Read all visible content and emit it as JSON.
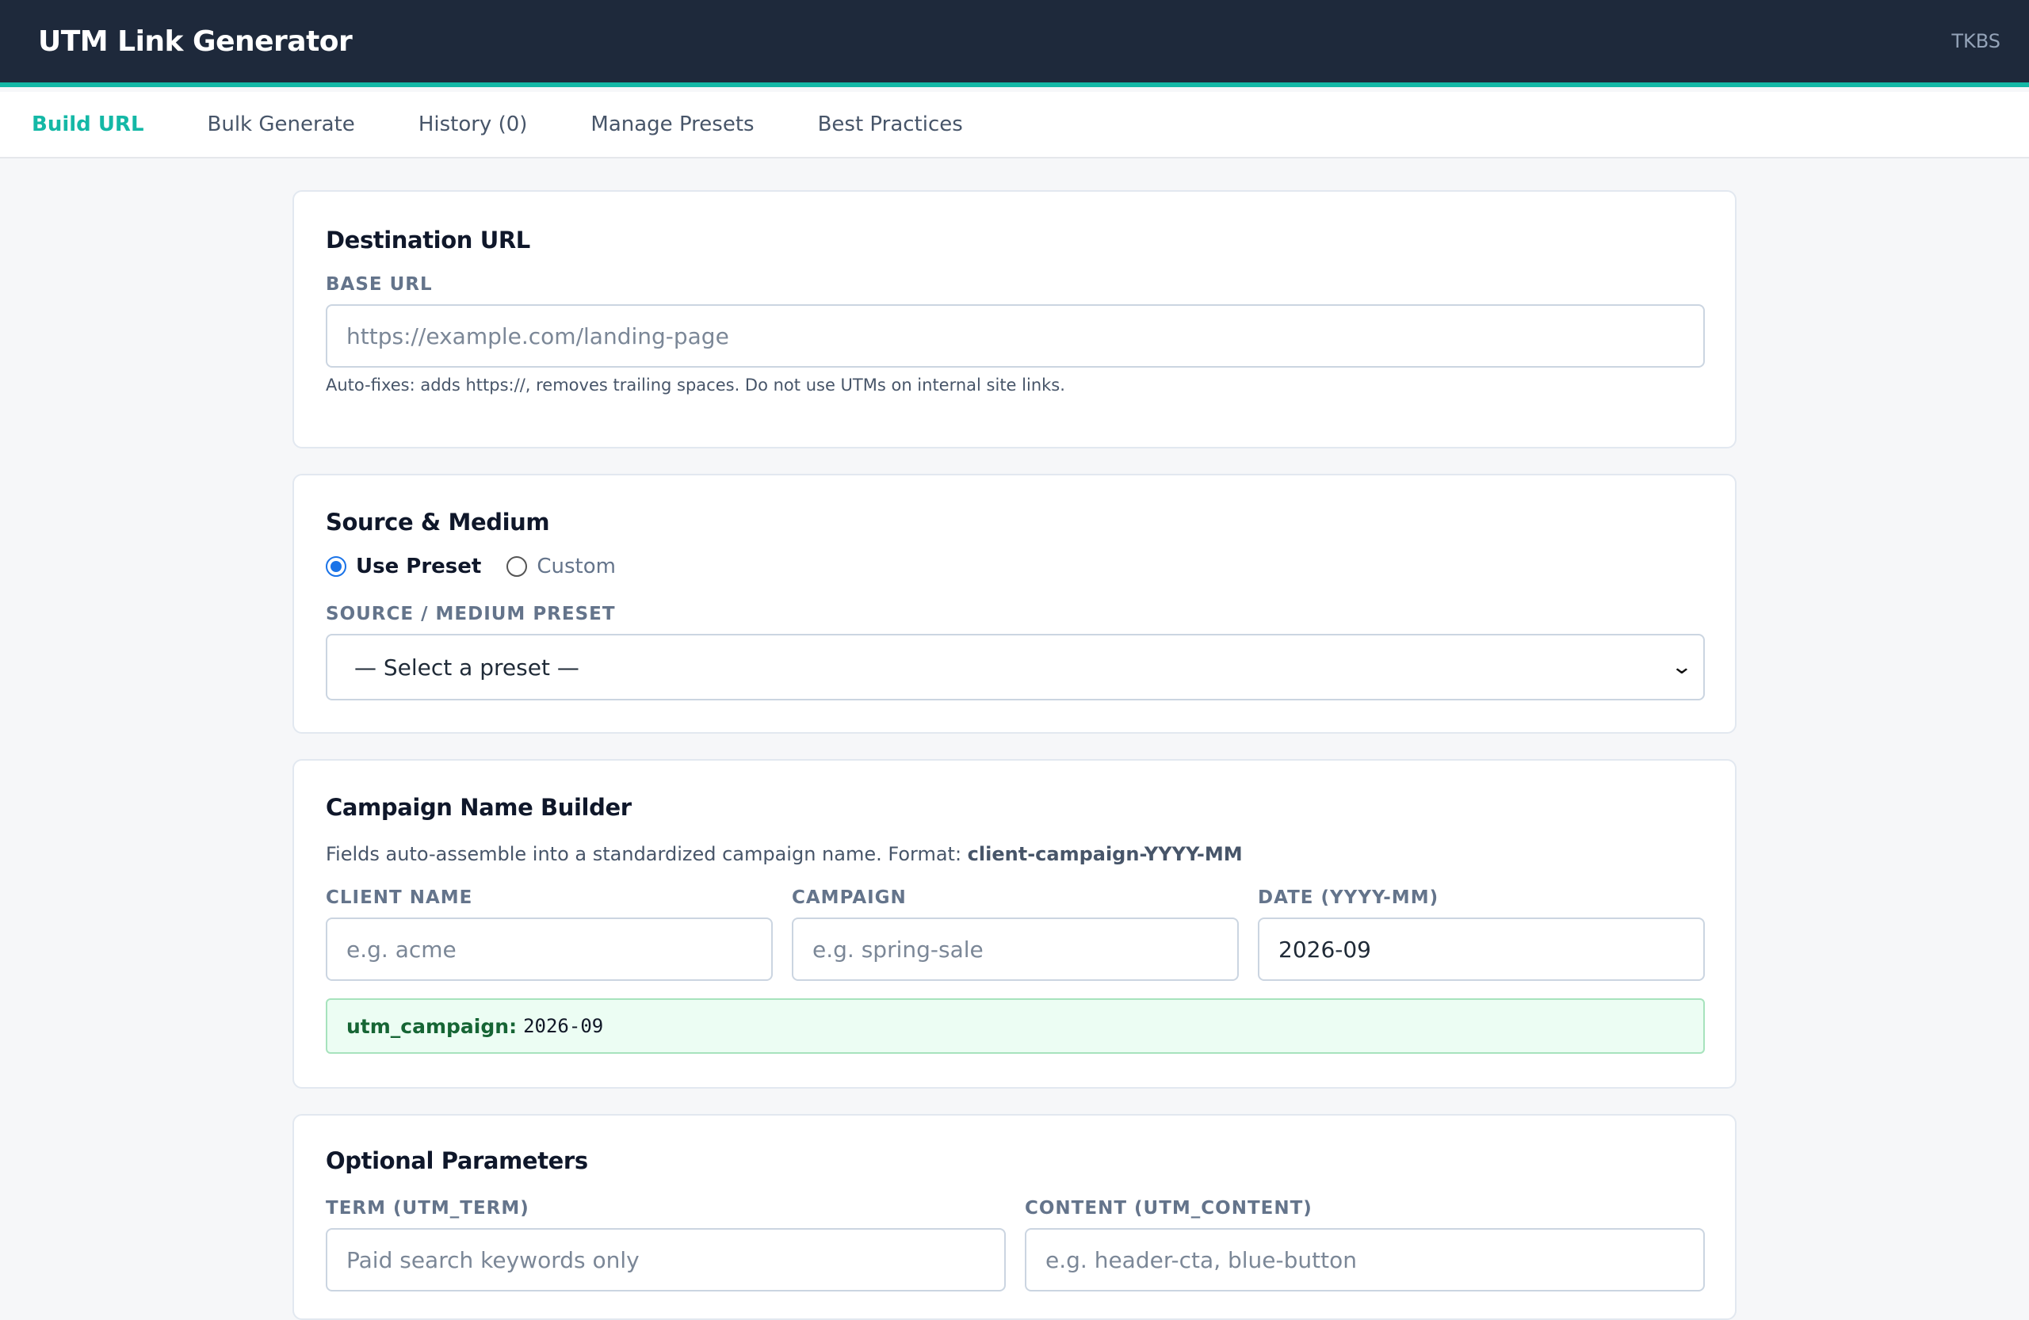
{
  "header": {
    "title": "UTM Link Generator",
    "user": "TKBS"
  },
  "tabs": [
    {
      "label": "Build URL",
      "active": true
    },
    {
      "label": "Bulk Generate",
      "active": false
    },
    {
      "label": "History (0)",
      "active": false
    },
    {
      "label": "Manage Presets",
      "active": false
    },
    {
      "label": "Best Practices",
      "active": false
    }
  ],
  "destination": {
    "title": "Destination URL",
    "base_url_label": "BASE URL",
    "base_url_placeholder": "https://example.com/landing-page",
    "base_url_value": "",
    "help": "Auto-fixes: adds https://, removes trailing spaces. Do not use UTMs on internal site links."
  },
  "source_medium": {
    "title": "Source & Medium",
    "mode_options": [
      "Use Preset",
      "Custom"
    ],
    "selected_mode": "Use Preset",
    "preset_label": "SOURCE / MEDIUM PRESET",
    "preset_selected": "— Select a preset —"
  },
  "campaign": {
    "title": "Campaign Name Builder",
    "description": "Fields auto-assemble into a standardized campaign name. Format:",
    "format": "client-campaign-YYYY-MM",
    "client_label": "CLIENT NAME",
    "client_placeholder": "e.g. acme",
    "campaign_label": "CAMPAIGN",
    "campaign_placeholder": "e.g. spring-sale",
    "date_label": "DATE (YYYY-MM)",
    "date_value": "2026-09",
    "result_key": "utm_campaign:",
    "result_value": "2026-09"
  },
  "optional": {
    "title": "Optional Parameters",
    "term_label": "TERM (UTM_TERM)",
    "term_placeholder": "Paid search keywords only",
    "content_label": "CONTENT (UTM_CONTENT)",
    "content_placeholder": "e.g. header-cta, blue-button"
  },
  "colors": {
    "header_bg": "#1e293b",
    "accent": "#14b8a6",
    "radio_accent": "#1a73e8",
    "result_bg": "#ecfdf3"
  }
}
